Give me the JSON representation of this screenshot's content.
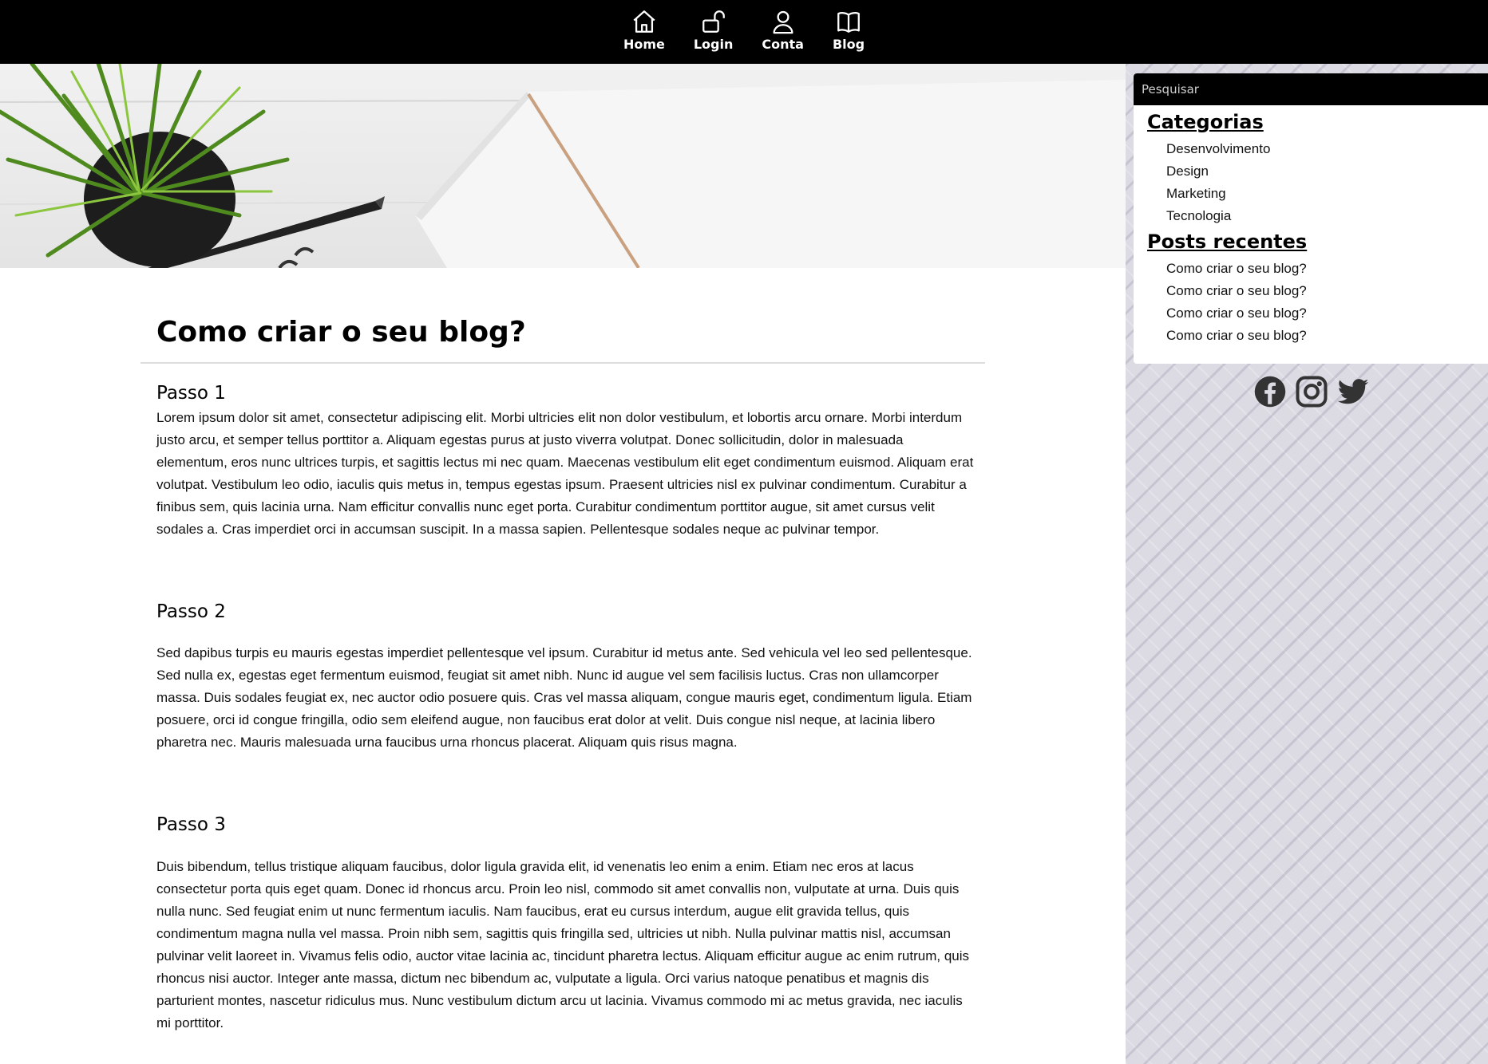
{
  "nav": {
    "items": [
      {
        "label": "Home",
        "icon": "home-icon"
      },
      {
        "label": "Login",
        "icon": "unlock-icon"
      },
      {
        "label": "Conta",
        "icon": "user-icon"
      },
      {
        "label": "Blog",
        "icon": "book-icon"
      }
    ]
  },
  "post": {
    "title": "Como criar o seu blog?",
    "steps": [
      {
        "heading": "Passo 1",
        "body": "Lorem ipsum dolor sit amet, consectetur adipiscing elit. Morbi ultricies elit non dolor vestibulum, et lobortis arcu ornare. Morbi interdum justo arcu, et semper tellus porttitor a. Aliquam egestas purus at justo viverra volutpat. Donec sollicitudin, dolor in malesuada elementum, eros nunc ultrices turpis, et sagittis lectus mi nec quam. Maecenas vestibulum elit eget condimentum euismod. Aliquam erat volutpat. Vestibulum leo odio, iaculis quis metus in, tempus egestas ipsum. Praesent ultricies nisl ex pulvinar condimentum. Curabitur a finibus sem, quis lacinia urna. Nam efficitur convallis nunc eget porta. Curabitur condimentum porttitor augue, sit amet cursus velit sodales a. Cras imperdiet orci in accumsan suscipit. In a massa sapien. Pellentesque sodales neque ac pulvinar tempor."
      },
      {
        "heading": "Passo 2",
        "body": "Sed dapibus turpis eu mauris egestas imperdiet pellentesque vel ipsum. Curabitur id metus ante. Sed vehicula vel leo sed pellentesque. Sed nulla ex, egestas eget fermentum euismod, feugiat sit amet nibh. Nunc id augue vel sem facilisis luctus. Cras non ullamcorper massa. Duis sodales feugiat ex, nec auctor odio posuere quis. Cras vel massa aliquam, congue mauris eget, condimentum ligula. Etiam posuere, orci id congue fringilla, odio sem eleifend augue, non faucibus erat dolor at velit. Duis congue nisl neque, at lacinia libero pharetra nec. Mauris malesuada urna faucibus urna rhoncus placerat. Aliquam quis risus magna."
      },
      {
        "heading": "Passo 3",
        "body": "Duis bibendum, tellus tristique aliquam faucibus, dolor ligula gravida elit, id venenatis leo enim a enim. Etiam nec eros at lacus consectetur porta quis eget quam. Donec id rhoncus arcu. Proin leo nisl, commodo sit amet convallis non, vulputate at urna. Duis quis nulla nunc. Sed feugiat enim ut nunc fermentum iaculis. Nam faucibus, erat eu cursus interdum, augue elit gravida tellus, quis condimentum magna nulla vel massa. Proin nibh sem, sagittis quis fringilla sed, ultricies ut nibh. Nulla pulvinar mattis nisl, accumsan pulvinar velit laoreet in. Vivamus felis odio, auctor vitae lacinia ac, tincidunt pharetra lectus. Aliquam efficitur augue ac enim rutrum, quis rhoncus nisi auctor. Integer ante massa, dictum nec bibendum ac, vulputate a ligula. Orci varius natoque penatibus et magnis dis parturient montes, nascetur ridiculus mus. Nunc vestibulum dictum arcu ut lacinia. Vivamus commodo mi ac metus gravida, nec iaculis mi porttitor."
      }
    ]
  },
  "sidebar": {
    "search_placeholder": "Pesquisar",
    "categories_title": "Categorias",
    "categories": [
      "Desenvolvimento",
      "Design",
      "Marketing",
      "Tecnologia"
    ],
    "recent_title": "Posts recentes",
    "recent_posts": [
      "Como criar o seu blog?",
      "Como criar o seu blog?",
      "Como criar o seu blog?",
      "Como criar o seu blog?"
    ],
    "socials": [
      "facebook-icon",
      "instagram-icon",
      "twitter-icon"
    ]
  },
  "colors": {
    "topbar": "#000000",
    "sidebar_bg": "#dcdae3",
    "text": "#111111"
  }
}
